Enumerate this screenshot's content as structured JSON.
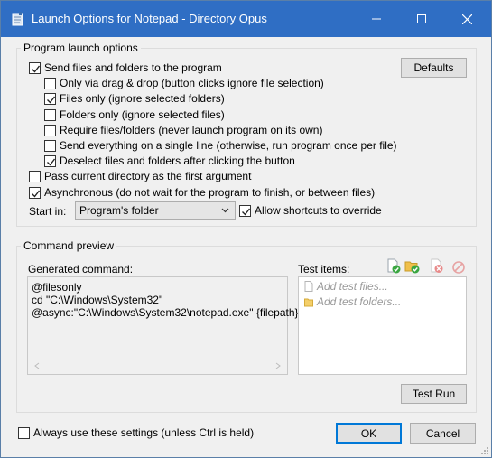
{
  "window": {
    "title": "Launch Options for Notepad - Directory Opus"
  },
  "launch": {
    "group_label": "Program launch options",
    "defaults_label": "Defaults",
    "options": [
      {
        "label": "Send files and folders to the program",
        "checked": true
      },
      {
        "label": "Only via drag & drop (button clicks ignore file selection)",
        "checked": false
      },
      {
        "label": "Files only (ignore selected folders)",
        "checked": true
      },
      {
        "label": "Folders only (ignore selected files)",
        "checked": false
      },
      {
        "label": "Require files/folders (never launch program on its own)",
        "checked": false
      },
      {
        "label": "Send everything on a single line (otherwise, run program once per file)",
        "checked": false
      },
      {
        "label": "Deselect files and folders after clicking the button",
        "checked": true
      },
      {
        "label": "Pass current directory as the first argument",
        "checked": false
      },
      {
        "label": "Asynchronous (do not wait for the program to finish, or between files)",
        "checked": true
      }
    ],
    "start_in_label": "Start in:",
    "start_in_value": "Program's folder",
    "allow_shortcuts_label": "Allow shortcuts to override",
    "allow_shortcuts_checked": true
  },
  "preview": {
    "group_label": "Command preview",
    "generated_label": "Generated command:",
    "command_lines": [
      "@filesonly",
      "cd \"C:\\Windows\\System32\"",
      "@async:\"C:\\Windows\\System32\\notepad.exe\" {filepath}"
    ],
    "test_items_label": "Test items:",
    "add_files": "Add test files...",
    "add_folders": "Add test folders...",
    "test_run_label": "Test Run"
  },
  "footer": {
    "always_use_label": "Always use these settings (unless Ctrl is held)",
    "always_use_checked": false,
    "ok_label": "OK",
    "cancel_label": "Cancel"
  }
}
